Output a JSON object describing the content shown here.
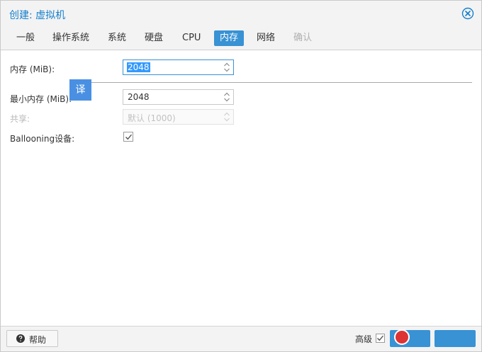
{
  "window": {
    "title": "创建: 虚拟机"
  },
  "tabs": [
    {
      "label": "一般",
      "state": "normal"
    },
    {
      "label": "操作系统",
      "state": "normal"
    },
    {
      "label": "系统",
      "state": "normal"
    },
    {
      "label": "硬盘",
      "state": "normal"
    },
    {
      "label": "CPU",
      "state": "normal"
    },
    {
      "label": "内存",
      "state": "active"
    },
    {
      "label": "网络",
      "state": "normal"
    },
    {
      "label": "确认",
      "state": "disabled"
    }
  ],
  "form": {
    "memory": {
      "label": "内存 (MiB):",
      "value": "2048"
    },
    "min_memory": {
      "label": "最小内存 (MiB):",
      "value": "2048"
    },
    "shares": {
      "label": "共享:",
      "placeholder": "默认 (1000)"
    },
    "ballooning": {
      "label": "Ballooning设备:",
      "checked": true
    }
  },
  "overlay": {
    "translate_badge": "译"
  },
  "footer": {
    "help_label": "帮助",
    "advanced_label": "高级",
    "advanced_checked": true,
    "back_label": "",
    "next_label": ""
  },
  "colors": {
    "accent": "#3892d4",
    "title": "#157fcc",
    "badge": "#4a90e2"
  }
}
